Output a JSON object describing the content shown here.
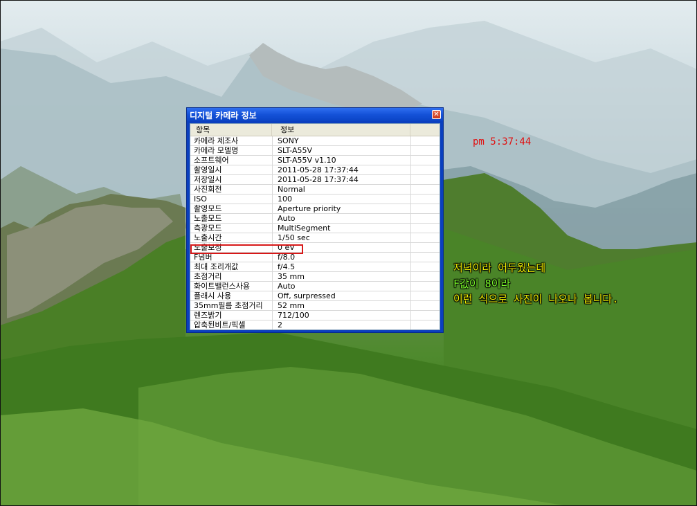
{
  "dialog": {
    "title": "디지털 카메라 정보",
    "close_glyph": "✕",
    "columns": [
      "항목",
      "정보",
      ""
    ],
    "rows": [
      {
        "key": "카메라 제조사",
        "value": "SONY"
      },
      {
        "key": "카메라 모델명",
        "value": "SLT-A55V"
      },
      {
        "key": "소프트웨어",
        "value": "SLT-A55V v1.10"
      },
      {
        "key": "촬영일시",
        "value": "2011-05-28  17:37:44"
      },
      {
        "key": "저장일시",
        "value": "2011-05-28  17:37:44"
      },
      {
        "key": "사진회전",
        "value": "Normal"
      },
      {
        "key": "ISO",
        "value": "100"
      },
      {
        "key": "촬영모드",
        "value": "Aperture priority"
      },
      {
        "key": "노출모드",
        "value": "Auto"
      },
      {
        "key": "측광모드",
        "value": "MultiSegment"
      },
      {
        "key": "노출시간",
        "value": "1/50 sec"
      },
      {
        "key": "노출보정",
        "value": "0 eV"
      },
      {
        "key": "F넘버",
        "value": "f/8.0"
      },
      {
        "key": "최대 조리개값",
        "value": "f/4.5"
      },
      {
        "key": "초점거리",
        "value": "35 mm"
      },
      {
        "key": "화이트밸런스사용",
        "value": "Auto"
      },
      {
        "key": "플래시 사용",
        "value": "Off, surpressed"
      },
      {
        "key": "35mm필름 초점거리",
        "value": "52 mm"
      },
      {
        "key": "렌즈밝기",
        "value": "712/100"
      },
      {
        "key": "압축된비트/픽셀",
        "value": "2"
      }
    ]
  },
  "overlay": {
    "clock": "pm 5:37:44",
    "caption_line1": "저녁이라 어두웠는데",
    "caption_line2": "F값이 8이라",
    "caption_line3": "이런 식으로 사진이 나오나 봅니다."
  },
  "colors": {
    "clock": "#e01010",
    "caption_yellow": "#f2f000",
    "caption_green": "#7cff2a",
    "highlight": "#d81818"
  }
}
